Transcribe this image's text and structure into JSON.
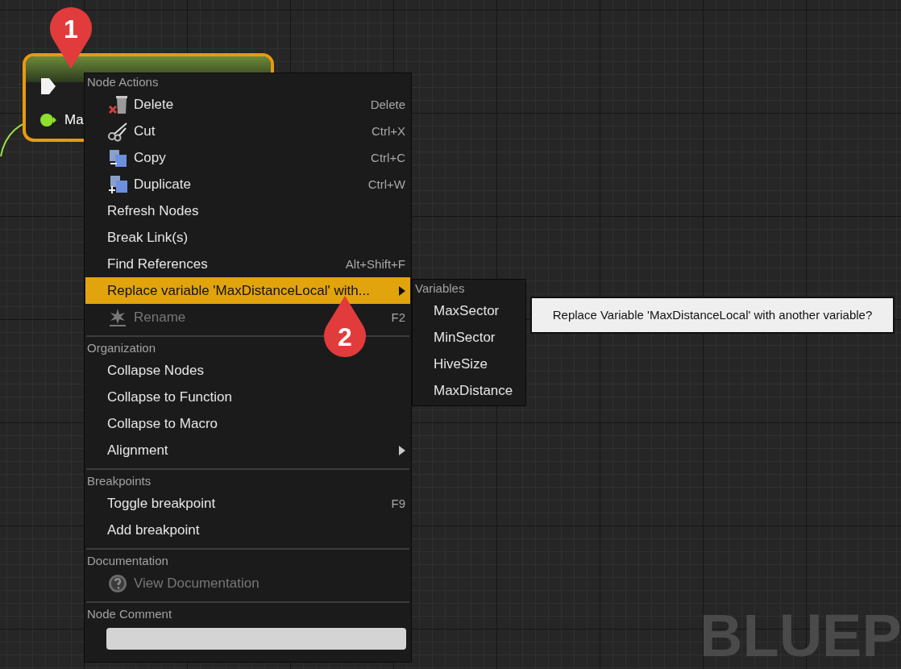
{
  "graph": {
    "node": {
      "selected": true,
      "pin_label": "Ma"
    },
    "watermark": "BLUEP"
  },
  "markers": [
    {
      "number": "1"
    },
    {
      "number": "2"
    }
  ],
  "context_menu": {
    "sections": [
      {
        "kind": "items",
        "heading": "Node Actions",
        "items": [
          {
            "label": "Delete",
            "shortcut": "Delete",
            "kind": "icon",
            "selected": false,
            "disabled": false,
            "submenu": false
          },
          {
            "label": "Cut",
            "shortcut": "Ctrl+X",
            "kind": "icon",
            "selected": false,
            "disabled": false,
            "submenu": false
          },
          {
            "label": "Copy",
            "shortcut": "Ctrl+C",
            "kind": "icon",
            "selected": false,
            "disabled": false,
            "submenu": false
          },
          {
            "label": "Duplicate",
            "shortcut": "Ctrl+W",
            "kind": "icon",
            "selected": false,
            "disabled": false,
            "submenu": false
          },
          {
            "label": "Refresh Nodes",
            "selected": false,
            "disabled": false,
            "submenu": false
          },
          {
            "label": "Break Link(s)",
            "selected": false,
            "disabled": false,
            "submenu": false
          },
          {
            "label": "Find References",
            "shortcut": "Alt+Shift+F",
            "selected": false,
            "disabled": false,
            "submenu": false
          },
          {
            "label": "Replace variable 'MaxDistanceLocal' with...",
            "selected": true,
            "disabled": false,
            "submenu": true
          },
          {
            "label": "Rename",
            "shortcut": "F2",
            "kind": "icon",
            "selected": false,
            "disabled": true,
            "submenu": false
          }
        ]
      },
      {
        "kind": "items",
        "heading": "Organization",
        "items": [
          {
            "label": "Collapse Nodes",
            "selected": false,
            "disabled": false,
            "submenu": false
          },
          {
            "label": "Collapse to Function",
            "selected": false,
            "disabled": false,
            "submenu": false
          },
          {
            "label": "Collapse to Macro",
            "selected": false,
            "disabled": false,
            "submenu": false
          },
          {
            "label": "Alignment",
            "selected": false,
            "disabled": false,
            "submenu": true
          }
        ]
      },
      {
        "kind": "items",
        "heading": "Breakpoints",
        "items": [
          {
            "label": "Toggle breakpoint",
            "shortcut": "F9",
            "selected": false,
            "disabled": false,
            "submenu": false
          },
          {
            "label": "Add breakpoint",
            "selected": false,
            "disabled": false,
            "submenu": false
          }
        ]
      },
      {
        "kind": "items",
        "heading": "Documentation",
        "items": [
          {
            "label": "View Documentation",
            "kind": "icon",
            "selected": false,
            "disabled": true,
            "submenu": false
          }
        ]
      },
      {
        "kind": "field",
        "heading": "Node Comment"
      }
    ]
  },
  "submenu": {
    "heading": "Variables",
    "items": [
      "MaxSector",
      "MinSector",
      "HiveSize",
      "MaxDistance"
    ]
  },
  "tooltip": {
    "text": "Replace Variable 'MaxDistanceLocal' with another variable?"
  }
}
